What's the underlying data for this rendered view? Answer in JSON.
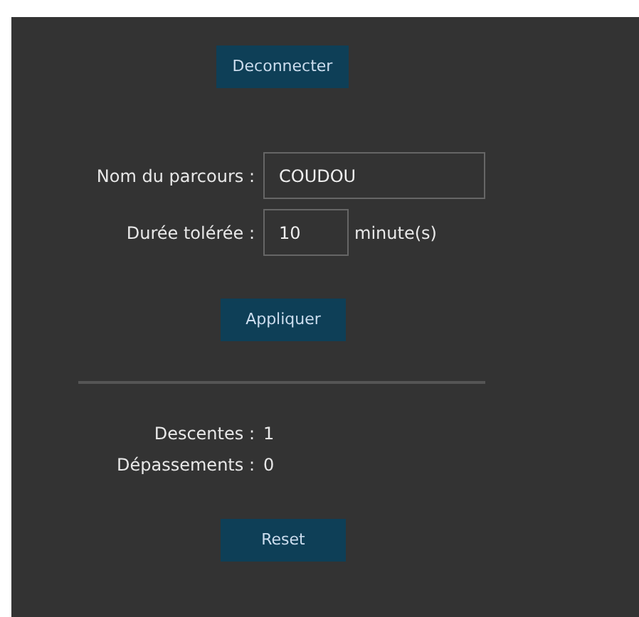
{
  "logout_button": "Deconnecter",
  "settings": {
    "route_name": {
      "label": "Nom du parcours :",
      "value": "COUDOU"
    },
    "tolerated_duration": {
      "label": "Durée tolérée :",
      "value": "10",
      "unit": "minute(s)"
    }
  },
  "apply_button": "Appliquer",
  "stats": [
    {
      "label": "Descentes :",
      "value": "1"
    },
    {
      "label": "Dépassements :",
      "value": "0"
    }
  ],
  "reset_button": "Reset"
}
